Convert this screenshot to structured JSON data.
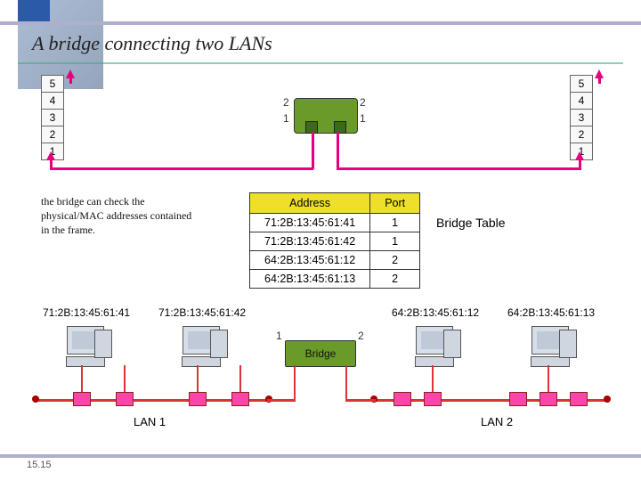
{
  "title": "A bridge connecting two LANs",
  "osi_layers": [
    "5",
    "4",
    "3",
    "2",
    "1"
  ],
  "bridge_ports": {
    "left_top": "2",
    "left_bottom": "1",
    "right_top": "2",
    "right_bottom": "1"
  },
  "note": "the bridge can check the physical/MAC addresses contained in the frame.",
  "table": {
    "headers": [
      "Address",
      "Port"
    ],
    "rows": [
      [
        "71:2B:13:45:61:41",
        "1"
      ],
      [
        "71:2B:13:45:61:42",
        "1"
      ],
      [
        "64:2B:13:45:61:12",
        "2"
      ],
      [
        "64:2B:13:45:61:13",
        "2"
      ]
    ],
    "label": "Bridge Table"
  },
  "macs": [
    "71:2B:13:45:61:41",
    "71:2B:13:45:61:42",
    "64:2B:13:45:61:12",
    "64:2B:13:45:61:13"
  ],
  "bridge2": {
    "label": "Bridge",
    "p1": "1",
    "p2": "2"
  },
  "lan1": "LAN 1",
  "lan2": "LAN 2",
  "page": "15.15"
}
